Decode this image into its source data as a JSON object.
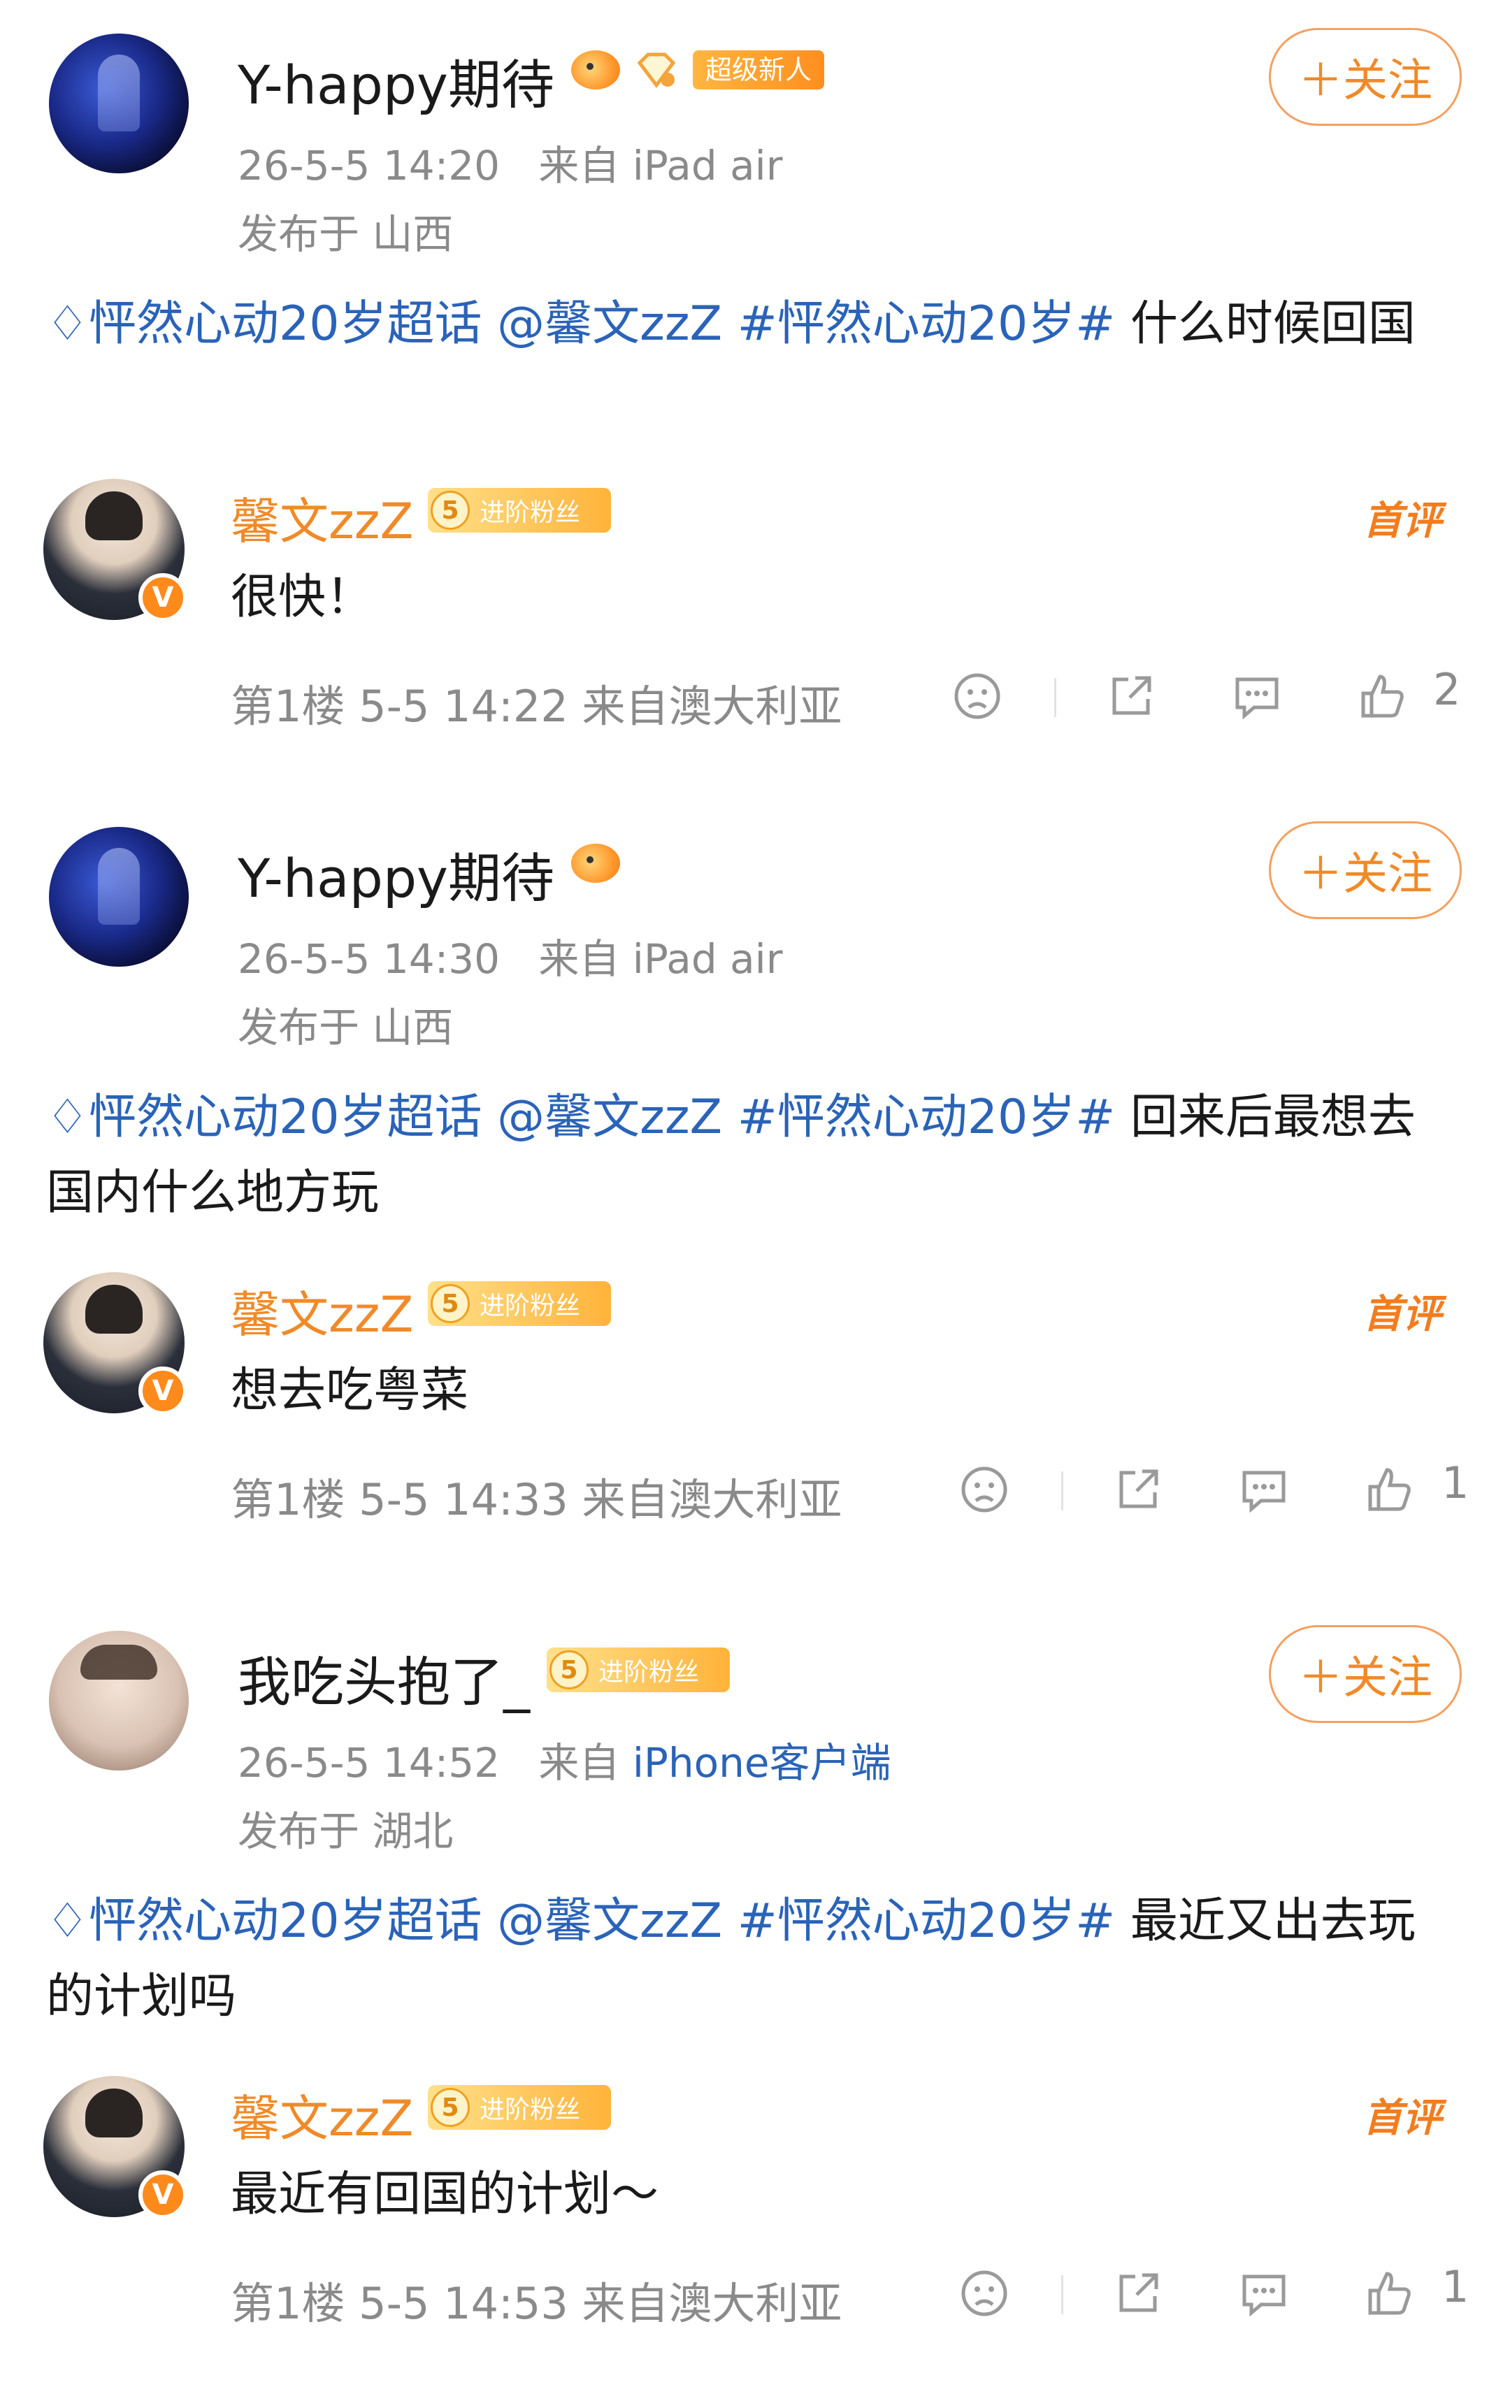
{
  "threads": [
    {
      "post": {
        "name": "Y-happy期待",
        "badge_tag": "超级新人",
        "time": "26-5-5 14:20",
        "device": "来自 iPad air",
        "location": "发布于 山西",
        "follow_label": "＋关注",
        "topic": "♢怦然心动20岁超话",
        "mention": "@馨文zzZ",
        "hashtag": "#怦然心动20岁#",
        "text": "什么时候回国"
      },
      "reply": {
        "name": "馨文zzZ",
        "fan_level": "5",
        "fan_label": "进阶粉丝",
        "first_comment": "首评",
        "text": "很快！",
        "floor": "第1楼",
        "time": "5-5 14:22",
        "source": "来自澳大利亚",
        "likes": "2"
      }
    },
    {
      "post": {
        "name": "Y-happy期待",
        "badge_tag": "",
        "time": "26-5-5 14:30",
        "device": "来自 iPad air",
        "location": "发布于 山西",
        "follow_label": "＋关注",
        "topic": "♢怦然心动20岁超话",
        "mention": "@馨文zzZ",
        "hashtag": "#怦然心动20岁#",
        "text": "回来后最想去国内什么地方玩"
      },
      "reply": {
        "name": "馨文zzZ",
        "fan_level": "5",
        "fan_label": "进阶粉丝",
        "first_comment": "首评",
        "text": "想去吃粤菜",
        "floor": "第1楼",
        "time": "5-5 14:33",
        "source": "来自澳大利亚",
        "likes": "1"
      }
    },
    {
      "post": {
        "name": "我吃头抱了_",
        "fan_level": "5",
        "fan_label": "进阶粉丝",
        "time": "26-5-5 14:52",
        "device_prefix": "来自",
        "device_link": "iPhone客户端",
        "location": "发布于 湖北",
        "follow_label": "＋关注",
        "topic": "♢怦然心动20岁超话",
        "mention": "@馨文zzZ",
        "hashtag": "#怦然心动20岁#",
        "text": "最近又出去玩的计划吗"
      },
      "reply": {
        "name": "馨文zzZ",
        "fan_level": "5",
        "fan_label": "进阶粉丝",
        "first_comment": "首评",
        "text": "最近有回国的计划～",
        "floor": "第1楼",
        "time": "5-5 14:53",
        "source": "来自澳大利亚",
        "likes": "1"
      }
    }
  ],
  "icons": [
    "fish-emoji-icon",
    "diamond-icon",
    "verified-v-icon",
    "sad-face-icon",
    "share-icon",
    "comment-icon",
    "thumbs-up-icon"
  ],
  "colors": {
    "accent": "#f08a28",
    "link": "#2a63b8",
    "meta": "#8a8a8a"
  }
}
